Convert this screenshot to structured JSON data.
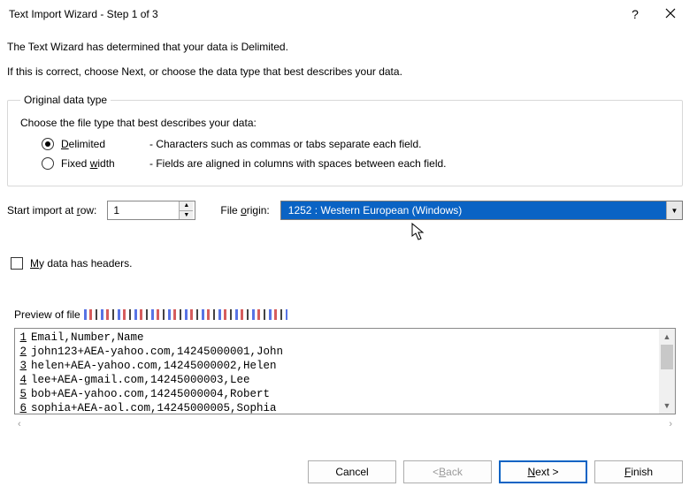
{
  "window": {
    "title": "Text Import Wizard - Step 1 of 3"
  },
  "intro": {
    "line1": "The Text Wizard has determined that your data is Delimited.",
    "line2": "If this is correct, choose Next, or choose the data type that best describes your data."
  },
  "group": {
    "legend": "Original data type",
    "choose": "Choose the file type that best describes your data:",
    "delimited": {
      "prefix": "D",
      "rest": "elimited",
      "desc": "-  Characters such as commas or tabs separate each field."
    },
    "fixed": {
      "prefix": "Fixed ",
      "ul": "w",
      "rest": "idth",
      "desc": "-  Fields are aligned in columns with spaces between each field."
    }
  },
  "start_row": {
    "label_pre": "Start import at ",
    "label_ul": "r",
    "label_post": "ow:",
    "value": "1"
  },
  "origin": {
    "label_pre": "File ",
    "label_ul": "o",
    "label_post": "rigin:",
    "value": "1252 : Western European (Windows)"
  },
  "headers": {
    "label_ul": "M",
    "label_rest": "y data has headers."
  },
  "preview": {
    "label": "Preview of file",
    "lines": [
      {
        "n": "1",
        "t": "Email,Number,Name"
      },
      {
        "n": "2",
        "t": "john123+AEA-yahoo.com,14245000001,John"
      },
      {
        "n": "3",
        "t": "helen+AEA-yahoo.com,14245000002,Helen"
      },
      {
        "n": "4",
        "t": "lee+AEA-gmail.com,14245000003,Lee"
      },
      {
        "n": "5",
        "t": "bob+AEA-yahoo.com,14245000004,Robert"
      },
      {
        "n": "6",
        "t": "sophia+AEA-aol.com,14245000005,Sophia"
      }
    ]
  },
  "buttons": {
    "cancel": "Cancel",
    "back_lt": "< ",
    "back_ul": "B",
    "back_rest": "ack",
    "next_ul": "N",
    "next_rest": "ext >",
    "finish_ul": "F",
    "finish_rest": "inish"
  }
}
